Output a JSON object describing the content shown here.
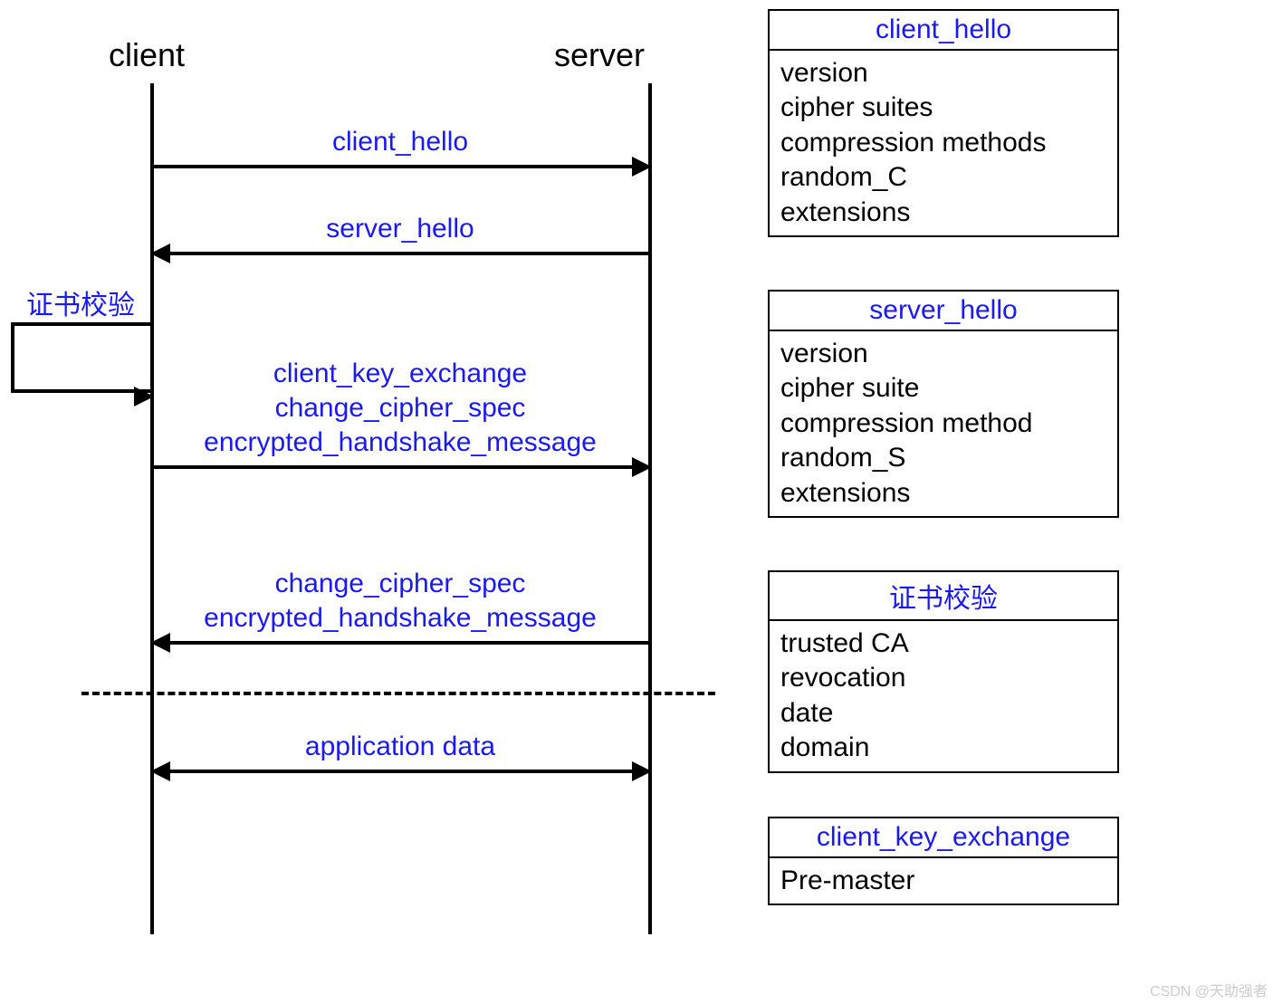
{
  "sequence": {
    "client_label": "client",
    "server_label": "server",
    "selfcall_label": "证书校验",
    "messages": {
      "m1": "client_hello",
      "m2": "server_hello",
      "m3a": "client_key_exchange",
      "m3b": "change_cipher_spec",
      "m3c": "encrypted_handshake_message",
      "m4a": "change_cipher_spec",
      "m4b": "encrypted_handshake_message",
      "m5": "application data"
    }
  },
  "boxes": {
    "client_hello": {
      "title": "client_hello",
      "items": [
        "version",
        "cipher suites",
        "compression methods",
        "random_C",
        "extensions"
      ]
    },
    "server_hello": {
      "title": "server_hello",
      "items": [
        "version",
        "cipher suite",
        "compression method",
        "random_S",
        "extensions"
      ]
    },
    "cert_verify": {
      "title": "证书校验",
      "items": [
        "trusted CA",
        "revocation",
        "date",
        "domain"
      ]
    },
    "client_key_exchange": {
      "title": "client_key_exchange",
      "items": [
        "Pre-master"
      ]
    }
  },
  "watermark": "CSDN @天助强者"
}
